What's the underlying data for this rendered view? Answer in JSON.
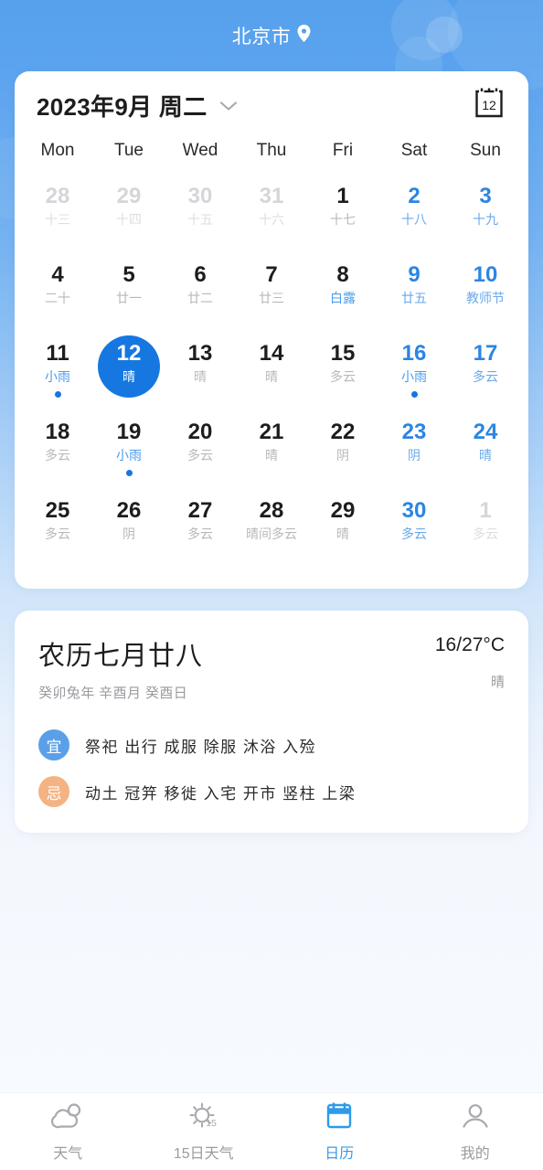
{
  "header": {
    "city": "北京市",
    "location_icon": "location-pin-icon"
  },
  "calendar": {
    "title": "2023年9月 周二",
    "dropdown_icon": "chevron-down-icon",
    "today_icon": "calendar-today-icon",
    "today_icon_number": "12",
    "weekdays": [
      "Mon",
      "Tue",
      "Wed",
      "Thu",
      "Fri",
      "Sat",
      "Sun"
    ],
    "weeks": [
      [
        {
          "day": "28",
          "sub": "十三",
          "state": "muted"
        },
        {
          "day": "29",
          "sub": "十四",
          "state": "muted"
        },
        {
          "day": "30",
          "sub": "十五",
          "state": "muted"
        },
        {
          "day": "31",
          "sub": "十六",
          "state": "muted"
        },
        {
          "day": "1",
          "sub": "十七",
          "state": "normal"
        },
        {
          "day": "2",
          "sub": "十八",
          "state": "weekend"
        },
        {
          "day": "3",
          "sub": "十九",
          "state": "weekend"
        }
      ],
      [
        {
          "day": "4",
          "sub": "二十",
          "state": "normal"
        },
        {
          "day": "5",
          "sub": "廿一",
          "state": "normal"
        },
        {
          "day": "6",
          "sub": "廿二",
          "state": "normal"
        },
        {
          "day": "7",
          "sub": "廿三",
          "state": "normal"
        },
        {
          "day": "8",
          "sub": "白露",
          "state": "normal",
          "sub_accent": true
        },
        {
          "day": "9",
          "sub": "廿五",
          "state": "weekend"
        },
        {
          "day": "10",
          "sub": "教师节",
          "state": "weekend"
        }
      ],
      [
        {
          "day": "11",
          "sub": "小雨",
          "state": "normal",
          "sub_accent": true,
          "dot": true
        },
        {
          "day": "12",
          "sub": "晴",
          "state": "selected"
        },
        {
          "day": "13",
          "sub": "晴",
          "state": "normal"
        },
        {
          "day": "14",
          "sub": "晴",
          "state": "normal"
        },
        {
          "day": "15",
          "sub": "多云",
          "state": "normal"
        },
        {
          "day": "16",
          "sub": "小雨",
          "state": "weekend",
          "sub_accent": true,
          "dot": true
        },
        {
          "day": "17",
          "sub": "多云",
          "state": "weekend"
        }
      ],
      [
        {
          "day": "18",
          "sub": "多云",
          "state": "normal"
        },
        {
          "day": "19",
          "sub": "小雨",
          "state": "normal",
          "sub_accent": true,
          "dot": true
        },
        {
          "day": "20",
          "sub": "多云",
          "state": "normal"
        },
        {
          "day": "21",
          "sub": "晴",
          "state": "normal"
        },
        {
          "day": "22",
          "sub": "阴",
          "state": "normal"
        },
        {
          "day": "23",
          "sub": "阴",
          "state": "weekend"
        },
        {
          "day": "24",
          "sub": "晴",
          "state": "weekend"
        }
      ],
      [
        {
          "day": "25",
          "sub": "多云",
          "state": "normal"
        },
        {
          "day": "26",
          "sub": "阴",
          "state": "normal"
        },
        {
          "day": "27",
          "sub": "多云",
          "state": "normal"
        },
        {
          "day": "28",
          "sub": "晴间多云",
          "state": "normal"
        },
        {
          "day": "29",
          "sub": "晴",
          "state": "normal"
        },
        {
          "day": "30",
          "sub": "多云",
          "state": "weekend"
        },
        {
          "day": "1",
          "sub": "多云",
          "state": "muted"
        }
      ]
    ]
  },
  "lunar": {
    "date": "农历七月廿八",
    "ganzhi": "癸卯兔年 辛酉月 癸酉日",
    "temperature": "16/27°C",
    "condition": "晴",
    "yi": {
      "badge": "宜",
      "items": "祭祀 出行 成服 除服 沐浴 入殓"
    },
    "ji": {
      "badge": "忌",
      "items": "动土 冠笄 移徙 入宅 开市 竖柱 上梁"
    }
  },
  "bottom_nav": {
    "items": [
      {
        "label": "天气",
        "icon": "cloud-sun-icon",
        "active": false
      },
      {
        "label": "15日天气",
        "icon": "sun-15-icon",
        "active": false
      },
      {
        "label": "日历",
        "icon": "calendar-icon",
        "active": true
      },
      {
        "label": "我的",
        "icon": "person-icon",
        "active": false
      }
    ]
  },
  "colors": {
    "accent": "#1677e0",
    "header_blue": "#56a0ec",
    "weekend_blue": "#2b85e4",
    "yi_badge": "#5b9fe8",
    "ji_badge": "#f3b383",
    "muted_gray": "#b9b9bd"
  }
}
